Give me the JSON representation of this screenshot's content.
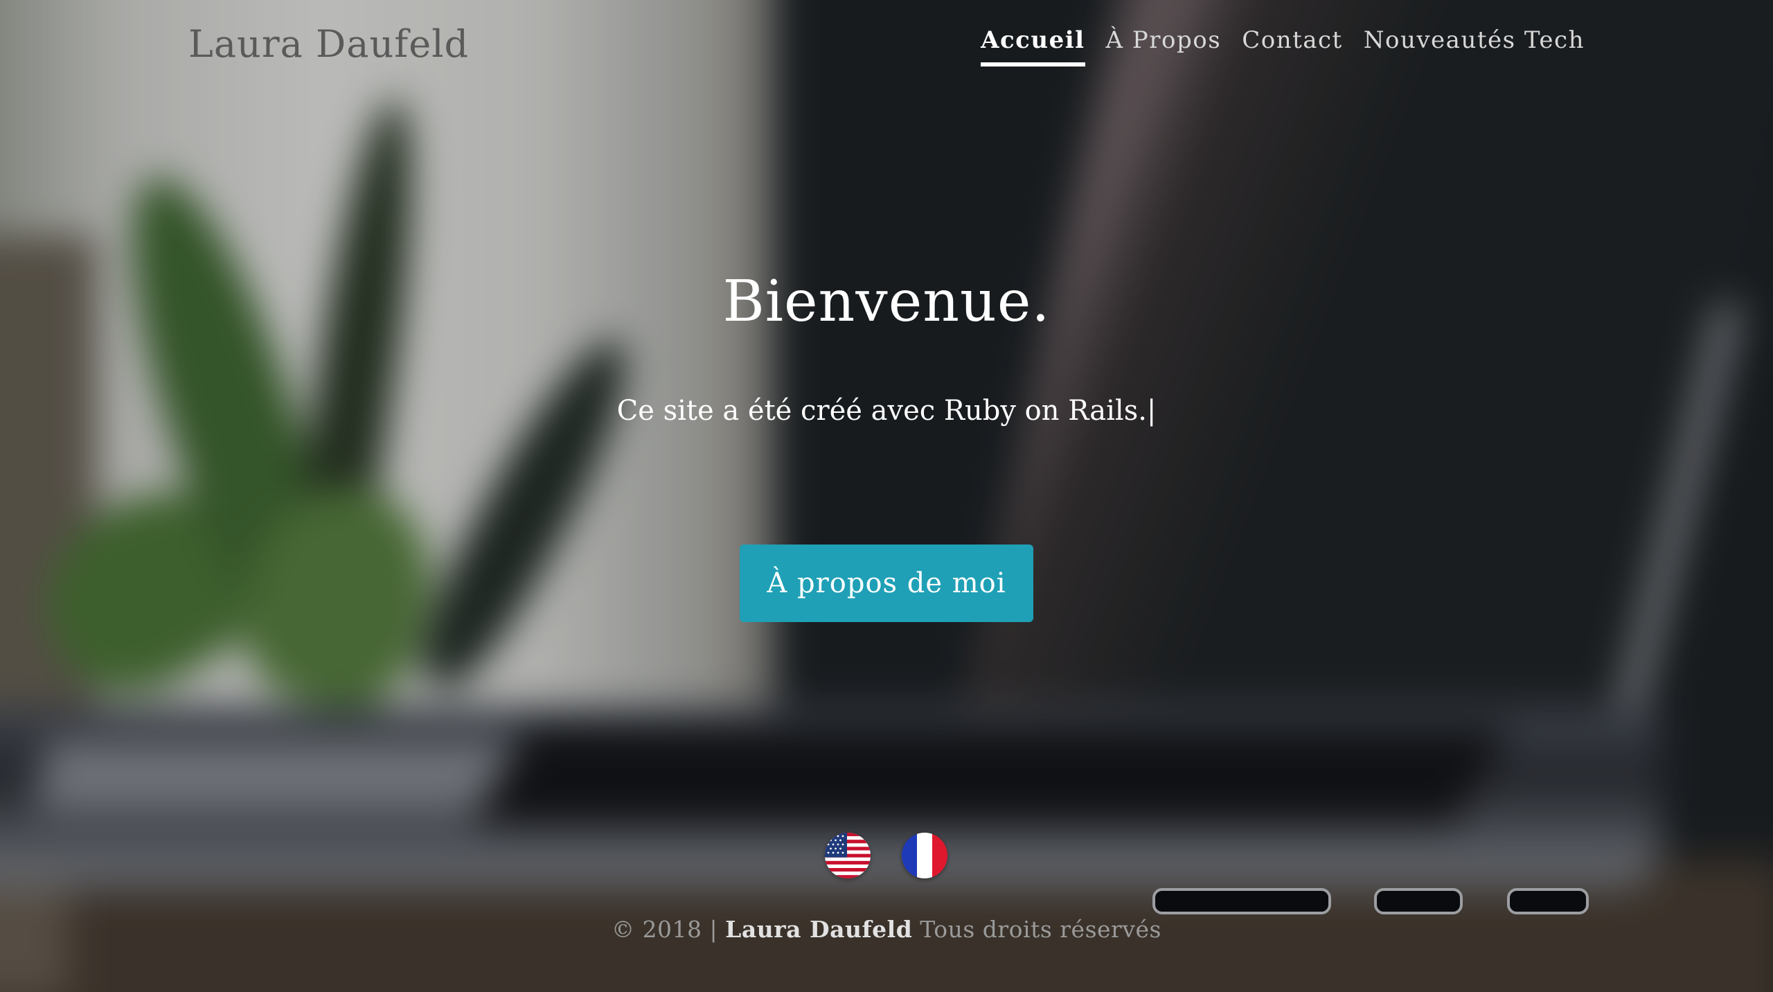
{
  "header": {
    "brand": "Laura Daufeld",
    "nav": [
      {
        "label": "Accueil",
        "active": true
      },
      {
        "label": "À Propos",
        "active": false
      },
      {
        "label": "Contact",
        "active": false
      },
      {
        "label": "Nouveautés Tech",
        "active": false
      }
    ]
  },
  "hero": {
    "title": "Bienvenue.",
    "subtitle": "Ce site a été créé avec Ruby on Rails.|",
    "cta_label": "À propos de moi"
  },
  "languages": [
    {
      "icon": "us-flag-icon",
      "code": "en"
    },
    {
      "icon": "france-flag-icon",
      "code": "fr"
    }
  ],
  "footer": {
    "copyright": "© 2018 |",
    "name": "Laura Daufeld",
    "rights": "Tous droits réservés"
  },
  "colors": {
    "accent": "#1fa0b6",
    "text_light": "#ffffff",
    "brand_gray": "#5a5a5a"
  }
}
